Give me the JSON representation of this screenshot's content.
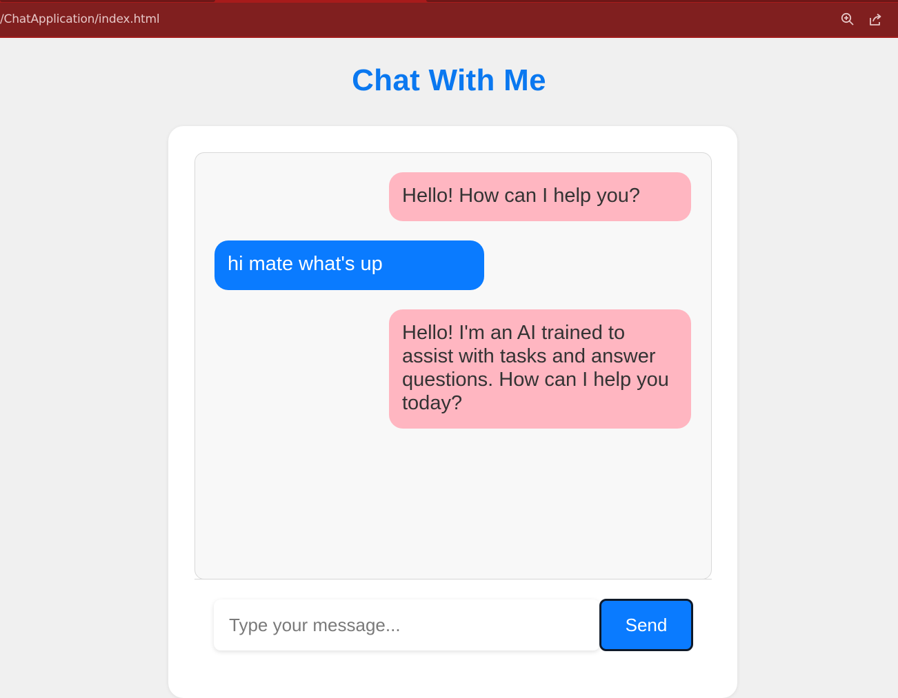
{
  "browser": {
    "url": "/ChatApplication/index.html",
    "icons": [
      "zoom-in-icon",
      "share-icon"
    ]
  },
  "page": {
    "title": "Chat With Me"
  },
  "chat": {
    "messages": [
      {
        "sender": "bot",
        "text": "Hello! How can I help you?"
      },
      {
        "sender": "user",
        "text": "hi mate what's up"
      },
      {
        "sender": "bot",
        "text": "Hello! I'm an AI trained to assist with tasks and answer questions. How can I help you today?"
      }
    ]
  },
  "composer": {
    "placeholder": "Type your message...",
    "value": "",
    "send_label": "Send"
  },
  "colors": {
    "title": "#0a78f0",
    "bot_bubble": "#ffb6c1",
    "user_bubble": "#0a7bff",
    "browser_bar": "#801f1f",
    "page_background": "#f0f0f0"
  }
}
